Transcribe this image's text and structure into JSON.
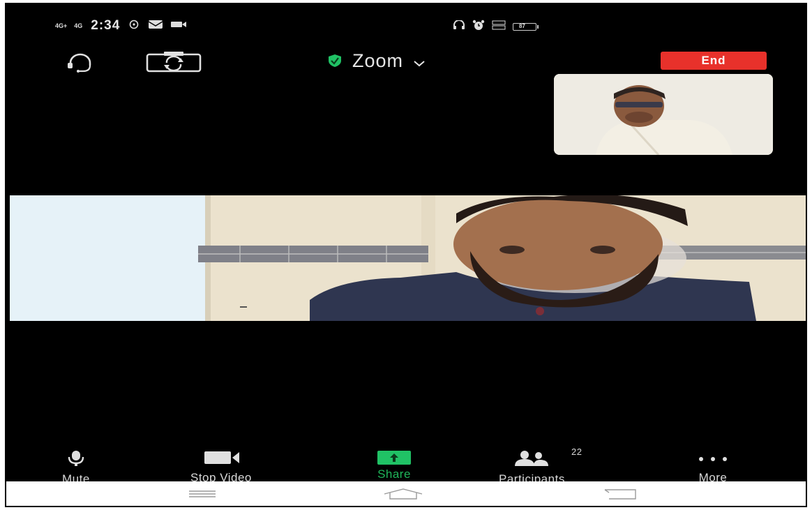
{
  "status_bar": {
    "network1": "4G+",
    "network2": "4G",
    "time": "2:34",
    "battery": "87",
    "icons": [
      "whatsapp-icon",
      "message-icon",
      "video-icon",
      "headphones-icon",
      "alarm-icon",
      "volte-icon",
      "battery-icon"
    ]
  },
  "top_bar": {
    "meeting_title": "Zoom",
    "end_label": "End",
    "icons": [
      "headset-icon",
      "switch-camera-icon",
      "shield-check-icon",
      "chevron-down-icon"
    ],
    "accent": "#e8312b",
    "secure": "#20c265"
  },
  "toolbar": {
    "mute_label": "Mute",
    "stop_video_label": "Stop Video",
    "share_label": "Share",
    "participants_label": "Participants",
    "participants_count": "22",
    "more_label": "More"
  },
  "nav_bar": {
    "icons": [
      "menu-icon",
      "home-icon",
      "back-icon"
    ]
  }
}
